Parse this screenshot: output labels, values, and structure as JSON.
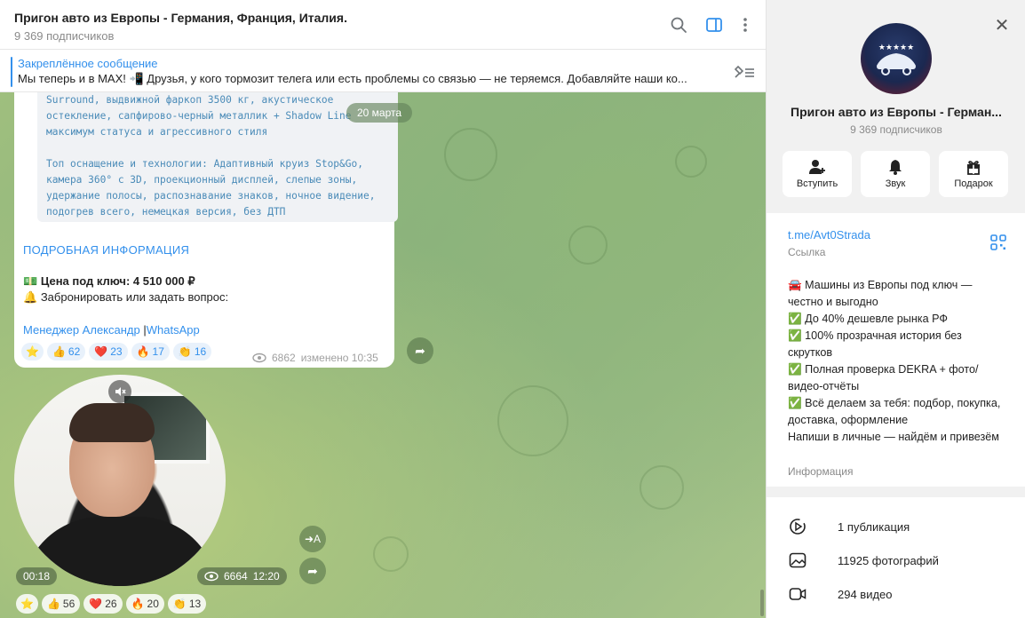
{
  "header": {
    "title": "Пригон авто из Европы - Германия, Франция, Италия.",
    "subscribers": "9 369 подписчиков"
  },
  "pinned": {
    "title": "Закреплённое сообщение",
    "text": "Мы теперь и в MAX! 📲 Друзья, у кого тормозит телега или есть проблемы со связью — не теряемся. Добавляйте наши ко..."
  },
  "message": {
    "code_lines": [
      "Surround, выдвижной фаркоп 3500 кг, акустическое",
      "остекление, сапфирово-черный металлик + Shadow Line",
      "максимум статуса и агрессивного стиля",
      "",
      "Топ оснащение и технологии: Адаптивный круиз Stop&Go,",
      "камера 360° с 3D, проекционный дисплей, слепые зоны,",
      "удержание полосы, распознавание знаков, ночное видение,",
      "подогрев всего, немецкая версия, без ДТП"
    ],
    "more_link": "ПОДРОБНАЯ ИНФОРМАЦИЯ",
    "price_label": "Цена под ключ: 4 510 000 ₽",
    "price_emoji": "💵",
    "book_emoji": "🔔",
    "book_text": "Забронировать или задать вопрос:",
    "manager_link": "Менеджер Александр",
    "separator": "|",
    "whatsapp_link": "WhatsApp",
    "reactions": [
      {
        "emoji": "⭐",
        "count": ""
      },
      {
        "emoji": "👍",
        "count": "62"
      },
      {
        "emoji": "❤️",
        "count": "23"
      },
      {
        "emoji": "🔥",
        "count": "17"
      },
      {
        "emoji": "👏",
        "count": "16"
      }
    ],
    "views": "6862",
    "edited": "изменено 10:35"
  },
  "date_pill": "20 марта",
  "video": {
    "duration": "00:18",
    "views": "6664",
    "time": "12:20",
    "reactions": [
      {
        "emoji": "⭐",
        "count": ""
      },
      {
        "emoji": "👍",
        "count": "56"
      },
      {
        "emoji": "❤️",
        "count": "26"
      },
      {
        "emoji": "🔥",
        "count": "20"
      },
      {
        "emoji": "👏",
        "count": "13"
      }
    ],
    "translate_label": "A"
  },
  "panel": {
    "name": "Пригон авто из Европы - Герман...",
    "subscribers": "9 369 подписчиков",
    "actions": [
      {
        "label": "Вступить",
        "icon": "add-user-icon"
      },
      {
        "label": "Звук",
        "icon": "bell-icon"
      },
      {
        "label": "Подарок",
        "icon": "gift-icon"
      }
    ],
    "link": "t.me/Avt0Strada",
    "link_label": "Ссылка",
    "description_lines": [
      "🚘 Машины из Европы под ключ — честно и выгодно",
      "✅ До 40% дешевле рынка РФ",
      "✅ 100% прозрачная история без скрутков",
      "✅ Полная проверка DEKRA + фото/видео-отчёты",
      "✅ Всё делаем за тебя: подбор, покупка, доставка, оформление",
      "Напиши в личные — найдём и привезём"
    ],
    "description_label": "Информация",
    "stats": [
      {
        "label": "1 публикация",
        "icon": "publication-icon"
      },
      {
        "label": "11925 фотографий",
        "icon": "photo-icon"
      },
      {
        "label": "294 видео",
        "icon": "video-icon"
      }
    ]
  },
  "colors": {
    "accent": "#3390ec",
    "chat_bg": "#9fbf7e"
  }
}
